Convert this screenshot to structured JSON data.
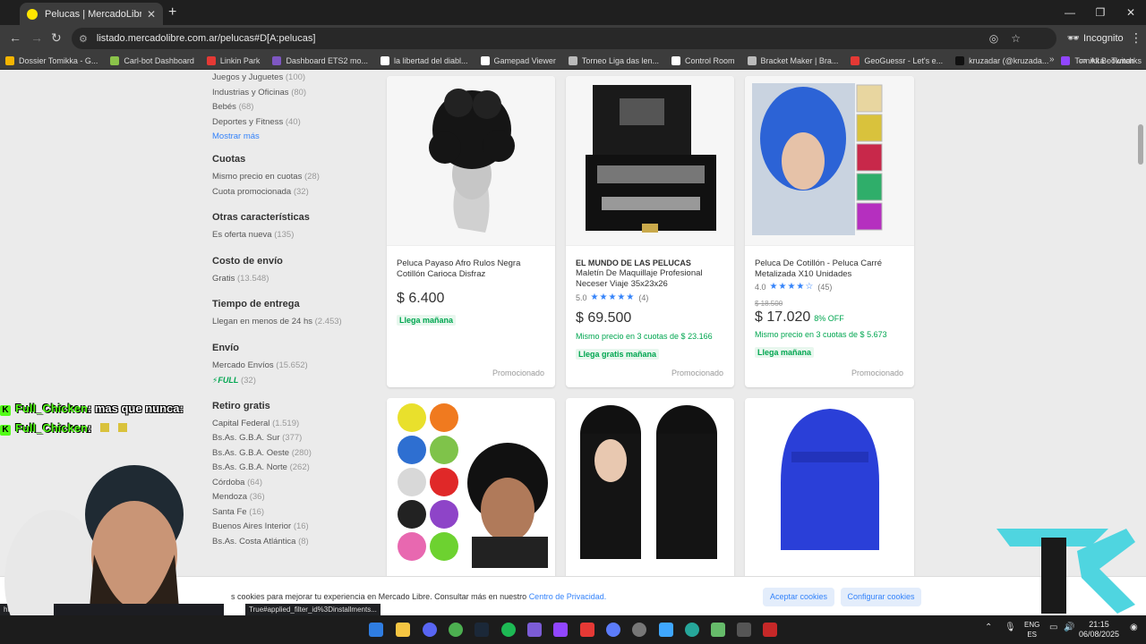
{
  "browser": {
    "tab_title": "Pelucas | MercadoLibre",
    "url": "listado.mercadolibre.com.ar/pelucas#D[A:pelucas]",
    "incognito_label": "Incognito",
    "bookmarks": [
      {
        "label": "Dossier Tomikka - G...",
        "color": "#f4b400"
      },
      {
        "label": "Carl-bot Dashboard",
        "color": "#8bc34a"
      },
      {
        "label": "Linkin Park",
        "color": "#e53935"
      },
      {
        "label": "Dashboard ETS2 mo...",
        "color": "#7e57c2"
      },
      {
        "label": "la libertad del diabl...",
        "color": "#ffffff"
      },
      {
        "label": "Gamepad Viewer",
        "color": "#ffffff"
      },
      {
        "label": "Torneo Liga das len...",
        "color": "#bbbbbb"
      },
      {
        "label": "Control Room",
        "color": "#ffffff"
      },
      {
        "label": "Bracket Maker | Bra...",
        "color": "#bbbbbb"
      },
      {
        "label": "GeoGuessr - Let's e...",
        "color": "#e53935"
      },
      {
        "label": "kruzadar (@kruzada...",
        "color": "#111111"
      },
      {
        "label": "Tomikka - Twitch",
        "color": "#9146ff"
      }
    ],
    "all_bookmarks": "All Bookmarks"
  },
  "sidebar": {
    "top_items": [
      {
        "label": "Juegos y Juguetes",
        "count": "(100)"
      },
      {
        "label": "Industrias y Oficinas",
        "count": "(80)"
      },
      {
        "label": "Bebés",
        "count": "(68)"
      },
      {
        "label": "Deportes y Fitness",
        "count": "(40)"
      }
    ],
    "show_more": "Mostrar más",
    "sections": [
      {
        "title": "Cuotas",
        "items": [
          {
            "label": "Mismo precio en cuotas",
            "count": "(28)"
          },
          {
            "label": "Cuota promocionada",
            "count": "(32)"
          }
        ]
      },
      {
        "title": "Otras características",
        "items": [
          {
            "label": "Es oferta nueva",
            "count": "(135)"
          }
        ]
      },
      {
        "title": "Costo de envío",
        "items": [
          {
            "label": "Gratis",
            "count": "(13.548)"
          }
        ]
      },
      {
        "title": "Tiempo de entrega",
        "items": [
          {
            "label": "Llegan en menos de 24 hs",
            "count": "(2.453)"
          }
        ]
      }
    ],
    "envio": {
      "title": "Envío",
      "items": [
        {
          "label": "Mercado Envíos",
          "count": "(15.652)"
        }
      ],
      "full_label": "FULL",
      "full_count": "(32)"
    },
    "retiro": {
      "title": "Retiro gratis",
      "items": [
        {
          "label": "Capital Federal",
          "count": "(1.519)"
        },
        {
          "label": "Bs.As. G.B.A. Sur",
          "count": "(377)"
        },
        {
          "label": "Bs.As. G.B.A. Oeste",
          "count": "(280)"
        },
        {
          "label": "Bs.As. G.B.A. Norte",
          "count": "(262)"
        },
        {
          "label": "Córdoba",
          "count": "(64)"
        },
        {
          "label": "Mendoza",
          "count": "(36)"
        },
        {
          "label": "Santa Fe",
          "count": "(16)"
        },
        {
          "label": "Buenos Aires Interior",
          "count": "(16)"
        },
        {
          "label": "Bs.As. Costa Atlántica",
          "count": "(8)"
        }
      ]
    }
  },
  "products": [
    {
      "title": "Peluca Payaso Afro Rulos Negra Cotillón Carioca Disfraz",
      "price": "$ 6.400",
      "delivery": "Llega mañana",
      "tag": "Promocionado"
    },
    {
      "brand": "EL MUNDO DE LAS PELUCAS",
      "title": "Maletín De Maquillaje Profesional Neceser Viaje 35x23x26",
      "rating": "5.0",
      "stars": "★★★★★",
      "reviews": "(4)",
      "price": "$ 69.500",
      "installments": "Mismo precio en 3 cuotas de $ 23.166",
      "delivery": "Llega gratis mañana",
      "tag": "Promocionado"
    },
    {
      "title": "Peluca De Cotillón - Peluca Carré Metalizada X10 Unidades",
      "rating": "4.0",
      "stars": "★★★★☆",
      "reviews": "(45)",
      "old_price": "$ 18.500",
      "price": "$ 17.020",
      "discount": "8% OFF",
      "installments": "Mismo precio en 3 cuotas de $ 5.673",
      "delivery": "Llega mañana",
      "tag": "Promocionado"
    }
  ],
  "chat": [
    {
      "user": "Full_Chicken",
      "msg": ": mas que nunca:"
    },
    {
      "user": "Full_Chicken",
      "msg": ":"
    }
  ],
  "cookie": {
    "text": "s cookies para mejorar tu experiencia en Mercado Libre. Consultar más en nuestro",
    "link": "Centro de Privacidad.",
    "accept": "Aceptar cookies",
    "configure": "Configurar cookies"
  },
  "status": {
    "left": "https:",
    "right": "True#applied_filter_id%3Dinstallments..."
  },
  "taskbar": {
    "lang_top": "ENG",
    "lang_bottom": "ES",
    "time": "21:15",
    "date": "06/08/2025"
  }
}
